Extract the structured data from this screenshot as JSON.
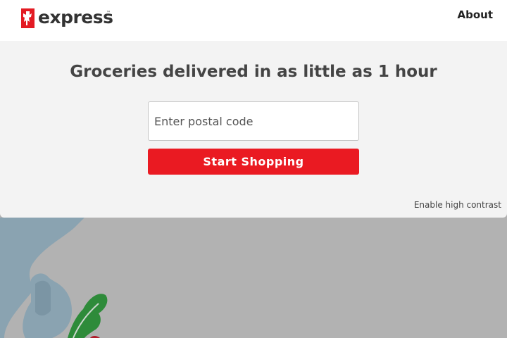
{
  "header": {
    "logo": {
      "text": "express",
      "trademark": "™",
      "brand_color": "#e31b23"
    },
    "nav": {
      "about_label": "About"
    }
  },
  "hero": {
    "headline": "Groceries delivered in as little as 1 hour",
    "postal_input": {
      "placeholder": "Enter postal code",
      "value": ""
    },
    "start_button_label": "Start Shopping",
    "contrast_link_label": "Enable high contrast"
  },
  "colors": {
    "accent": "#ea1a22",
    "hero_background": "#f3f3f3",
    "page_background": "#b2b2b2"
  }
}
